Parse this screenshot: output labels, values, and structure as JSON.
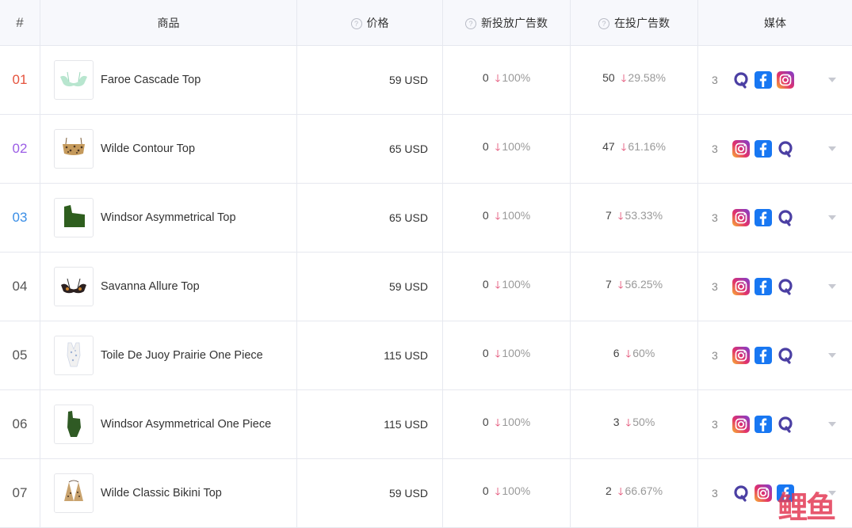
{
  "header": {
    "rank": "#",
    "product": "商品",
    "price": "价格",
    "new_ads": "新投放广告数",
    "running_ads": "在投广告数",
    "media": "媒体"
  },
  "rows": [
    {
      "rank": "01",
      "rank_color": "#e5533d",
      "name": "Faroe Cascade Top",
      "price": "59 USD",
      "new": "0",
      "new_pct": "100%",
      "run": "50",
      "run_pct": "29.58%",
      "media_count": "3",
      "icons": [
        "quora-icon",
        "facebook-icon",
        "instagram-icon"
      ],
      "thumb": "mint-bikini-top"
    },
    {
      "rank": "02",
      "rank_color": "#9b5de5",
      "name": "Wilde Contour Top",
      "price": "65 USD",
      "new": "0",
      "new_pct": "100%",
      "run": "47",
      "run_pct": "61.16%",
      "media_count": "3",
      "icons": [
        "instagram-icon",
        "facebook-icon",
        "quora-icon"
      ],
      "thumb": "leopard-bikini-top"
    },
    {
      "rank": "03",
      "rank_color": "#3a8ee6",
      "name": "Windsor Asymmetrical Top",
      "price": "65 USD",
      "new": "0",
      "new_pct": "100%",
      "run": "7",
      "run_pct": "53.33%",
      "media_count": "3",
      "icons": [
        "instagram-icon",
        "facebook-icon",
        "quora-icon"
      ],
      "thumb": "green-asymmetrical-top"
    },
    {
      "rank": "04",
      "rank_color": "#555555",
      "name": "Savanna Allure Top",
      "price": "59 USD",
      "new": "0",
      "new_pct": "100%",
      "run": "7",
      "run_pct": "56.25%",
      "media_count": "3",
      "icons": [
        "instagram-icon",
        "facebook-icon",
        "quora-icon"
      ],
      "thumb": "dark-floral-bikini-top"
    },
    {
      "rank": "05",
      "rank_color": "#555555",
      "name": "Toile De Juoy Prairie One Piece",
      "price": "115 USD",
      "new": "0",
      "new_pct": "100%",
      "run": "6",
      "run_pct": "60%",
      "media_count": "3",
      "icons": [
        "instagram-icon",
        "facebook-icon",
        "quora-icon"
      ],
      "thumb": "toile-one-piece"
    },
    {
      "rank": "06",
      "rank_color": "#555555",
      "name": "Windsor Asymmetrical One Piece",
      "price": "115 USD",
      "new": "0",
      "new_pct": "100%",
      "run": "3",
      "run_pct": "50%",
      "media_count": "3",
      "icons": [
        "instagram-icon",
        "facebook-icon",
        "quora-icon"
      ],
      "thumb": "green-one-piece"
    },
    {
      "rank": "07",
      "rank_color": "#555555",
      "name": "Wilde Classic Bikini Top",
      "price": "59 USD",
      "new": "0",
      "new_pct": "100%",
      "run": "2",
      "run_pct": "66.67%",
      "media_count": "3",
      "icons": [
        "quora-icon",
        "instagram-icon",
        "facebook-icon"
      ],
      "thumb": "leopard-triangle-top"
    }
  ],
  "watermark": "鲤鱼",
  "colors": {
    "down_arrow": "#e0416a",
    "facebook": "#1877f2",
    "quora": "#4b3fa3"
  }
}
